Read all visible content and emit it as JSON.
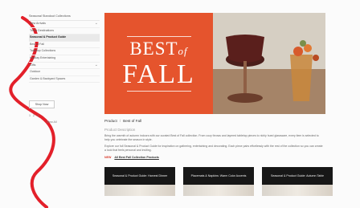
{
  "sidebar": {
    "heading": "Seasonal Standout Collections",
    "items": [
      {
        "label": "New Arrivals",
        "has_chevron": true
      },
      {
        "label": "Trend Destinations",
        "has_chevron": false
      },
      {
        "label": "Seasonal & Product Guide",
        "has_chevron": false,
        "active": true
      },
      {
        "label": "Best of Fall",
        "has_chevron": false
      },
      {
        "label": "Tabletop Collections",
        "has_chevron": false
      },
      {
        "label": "Holiday Entertaining",
        "has_chevron": false
      },
      {
        "label": "Gifts",
        "has_chevron": true
      },
      {
        "label": "Outdoor",
        "has_chevron": false
      },
      {
        "label": "Garden & Backyard Spaces",
        "has_chevron": false
      }
    ],
    "button_label": "Shop Now",
    "pager": [
      "1",
      "2",
      "3"
    ],
    "small_link": "View All"
  },
  "hero": {
    "best": "BEST",
    "of": "of",
    "fall": "FALL"
  },
  "breadcrumb": [
    "Product",
    "Best of Fall"
  ],
  "description_title": "Product Description",
  "paragraphs": [
    "Bring the warmth of autumn indoors with our curated Best of Fall collection. From cozy throws and layered tabletop pieces to richly hued glassware, every item is selected to help you celebrate the season in style.",
    "Explore our full Seasonal & Product Guide for inspiration on gathering, entertaining and decorating. Each piece pairs effortlessly with the rest of the collection so you can create a look that feels personal and inviting."
  ],
  "link_row": {
    "tag": "NEW",
    "link": "All Best Fall Collection Products"
  },
  "cards": [
    {
      "label": "Seasonal & Product Guide: Harvest Dinner"
    },
    {
      "label": "Placemats & Napkins: Warm Color Accents"
    },
    {
      "label": "Seasonal & Product Guide: Autumn Table"
    }
  ],
  "colors": {
    "hero_orange": "#e5542d",
    "card_dark": "#171717",
    "accent_red": "#d93a2b"
  }
}
